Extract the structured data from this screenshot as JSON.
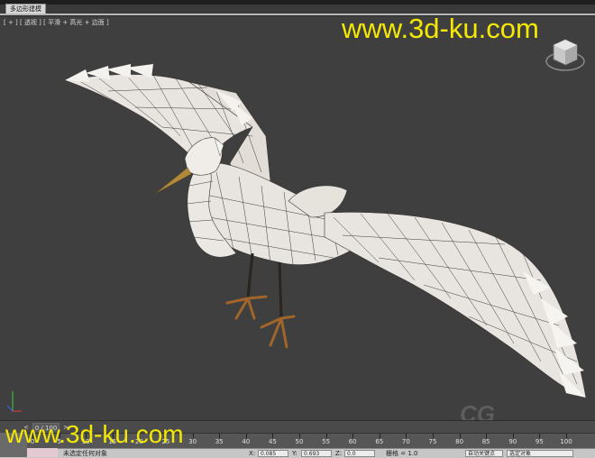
{
  "ribbon": {
    "tab_label": "多边形建模"
  },
  "viewport": {
    "label": "[ + ] [ 透视 ] [ 平滑 + 高光 + 边面 ]",
    "watermark": "www.3d-ku.com",
    "faint_logo": "CG"
  },
  "timeline": {
    "frame_counter": "0 / 100",
    "prev_label": "<",
    "next_label": ">"
  },
  "trackbar": {
    "ticks": [
      "0",
      "5",
      "10",
      "15",
      "20",
      "25",
      "30",
      "35",
      "40",
      "45",
      "50",
      "55",
      "60",
      "65",
      "70",
      "75",
      "80",
      "85",
      "90",
      "95",
      "100"
    ]
  },
  "status": {
    "selection_text": "未选定任何对象",
    "x_label": "X:",
    "x_value": "0.085",
    "y_label": "Y:",
    "y_value": "0.693",
    "z_label": "Z:",
    "z_value": "0.0",
    "grid_label": "栅格 = 1.0",
    "autokey_label": "自动关键点",
    "selection_dropdown": "选定对象"
  },
  "watermark_bottom": "www.3d-ku.com",
  "colors": {
    "viewport_bg": "#3f3f3f",
    "watermark": "#f4e800",
    "bird_body": "#e8e4df",
    "wire": "#333333"
  }
}
